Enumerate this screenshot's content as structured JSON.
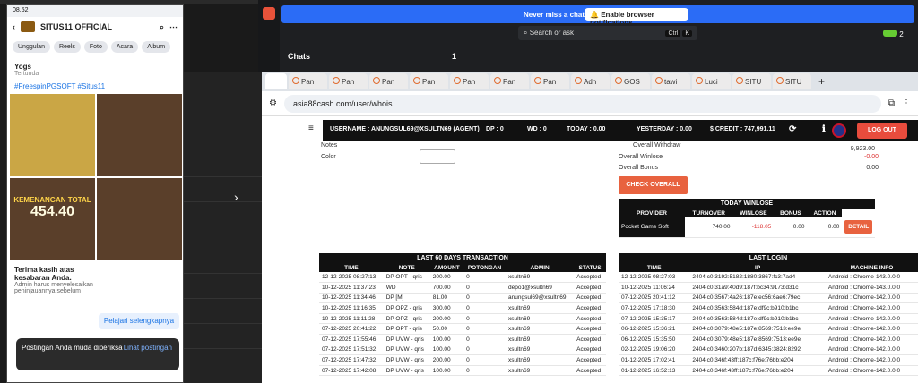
{
  "phone": {
    "status_time": "08.52",
    "page_title": "SITUS11 OFFICIAL",
    "chips": [
      "Unggulan",
      "Reels",
      "Foto",
      "Acara",
      "Album"
    ],
    "post_author": "Yogs",
    "post_sub": "Tertunda",
    "post_tags": "#FreespinPGSOFT #Situs11",
    "tile_caption": "KEMENANGAN TOTAL",
    "tile_value": "454.40",
    "ad_title": "Terima kasih atas kesabaran Anda.",
    "ad_body": "Admin harus menyelesaikan peninjauannya sebelum",
    "learn_more": "Pelajari selengkapnya",
    "toast_text": "Postingan Anda muda diperiksa",
    "toast_action": "Lihat postingan"
  },
  "chat": {
    "banner_msg": "Never miss a chat!",
    "banner_btn": "Enable browser notifications",
    "search": "Search or ask",
    "kbd1": "Ctrl",
    "kbd2": "K",
    "chats": "Chats",
    "count": "1",
    "badge": "2"
  },
  "browser": {
    "tabs": [
      "Pan",
      "Pan",
      "Pan",
      "Pan",
      "Pan",
      "Pan",
      "Pan",
      "Adn",
      "GOS",
      "tawi",
      "Luci",
      "SITU",
      "SITU"
    ],
    "url": "asia88cash.com/user/whois"
  },
  "site": {
    "username": "USERNAME : ANUNGSUL69@XSULTN69 (AGENT)",
    "dp": "DP : 0",
    "wd": "WD : 0",
    "today": "TODAY : 0.00",
    "yesterday": "YESTERDAY : 0.00",
    "credit": "$ CREDIT : 747,991.11",
    "logout": "LOG OUT",
    "notes_label": "Notes",
    "color_label": "Color",
    "overall_withdraw": "Overall Withdraw",
    "overall_withdraw_val": "9,923.00",
    "overall_winlose": "Overall Winlose",
    "overall_winlose_val": "-0.00",
    "overall_bonus": "Overall Bonus",
    "overall_bonus_val": "0.00",
    "check_overall": "CHECK OVERALL",
    "today_winlose_title": "TODAY WINLOSE",
    "winlose_headers": [
      "PROVIDER",
      "TURNOVER",
      "WINLOSE",
      "BONUS",
      "ACTION"
    ],
    "winlose_row": [
      "Pocket Game Soft",
      "740.00",
      "-118.05",
      "0.00",
      "0.00"
    ],
    "detail": "DETAIL",
    "tx_title": "LAST 60 DAYS TRANSACTION",
    "tx_headers": [
      "TIME",
      "NOTE",
      "AMOUNT",
      "POTONGAN",
      "ADMIN",
      "STATUS"
    ],
    "tx_rows": [
      [
        "12-12-2025 08:27:13",
        "DP OPT - qris",
        "200.00",
        "0",
        "xsultn69",
        "Accepted"
      ],
      [
        "10-12-2025 11:37:23",
        "WD",
        "700.00",
        "0",
        "depo1@xsultn69",
        "Accepted"
      ],
      [
        "10-12-2025 11:34:46",
        "DP [M]",
        "81.00",
        "0",
        "anungsul69@xsultn69",
        "Accepted"
      ],
      [
        "10-12-2025 11:16:35",
        "DP OPZ - qris",
        "300.00",
        "0",
        "xsultn69",
        "Accepted"
      ],
      [
        "10-12-2025 11:11:28",
        "DP OPZ - qris",
        "200.00",
        "0",
        "xsultn69",
        "Accepted"
      ],
      [
        "07-12-2025 20:41:22",
        "DP OPT - qris",
        "50.00",
        "0",
        "xsultn69",
        "Accepted"
      ],
      [
        "07-12-2025 17:55:46",
        "DP UVW - qris",
        "100.00",
        "0",
        "xsultn69",
        "Accepted"
      ],
      [
        "07-12-2025 17:51:32",
        "DP UVW - qris",
        "100.00",
        "0",
        "xsultn69",
        "Accepted"
      ],
      [
        "07-12-2025 17:47:32",
        "DP UVW - qris",
        "200.00",
        "0",
        "xsultn69",
        "Accepted"
      ],
      [
        "07-12-2025 17:42:08",
        "DP UVW - qris",
        "100.00",
        "0",
        "xsultn69",
        "Accepted"
      ]
    ],
    "login_title": "LAST LOGIN",
    "login_headers": [
      "TIME",
      "IP",
      "MACHINE INFO"
    ],
    "login_rows": [
      [
        "12-12-2025 08:27:03",
        "2404:c0:3192:5182:1880:3867:fc3:7ad4",
        "Android : Chrome-143.0.0.0"
      ],
      [
        "10-12-2025 11:06:24",
        "2404:c0:31a9:40d9:187f:bc34:9173:d31c",
        "Android : Chrome-143.0.0.0"
      ],
      [
        "07-12-2025 20:41:12",
        "2404:c0:3567:4a26:187e:ec56:6ae6:79ec",
        "Android : Chrome-142.0.0.0"
      ],
      [
        "07-12-2025 17:18:30",
        "2404:c0:3563:584d:187e:df9c:b910:b1bc",
        "Android : Chrome-142.0.0.0"
      ],
      [
        "07-12-2025 15:35:17",
        "2404:c0:3563:584d:187e:df9c:b910:b1bc",
        "Android : Chrome-142.0.0.0"
      ],
      [
        "06-12-2025 15:36:21",
        "2404:c0:3079:48e5:187e:8569:7513:ee9e",
        "Android : Chrome-142.0.0.0"
      ],
      [
        "06-12-2025 15:35:50",
        "2404:c0:3079:48e5:187e:8569:7513:ee9e",
        "Android : Chrome-142.0.0.0"
      ],
      [
        "02-12-2025 19:06:20",
        "2404:c0:3460:207b:187d:6345:3824:8292",
        "Android : Chrome-142.0.0.0"
      ],
      [
        "01-12-2025 17:02:41",
        "2404:c0:346f:43ff:187c:f76e:76bb:e204",
        "Android : Chrome-142.0.0.0"
      ],
      [
        "01-12-2025 16:52:13",
        "2404:c0:346f:43ff:187c:f76e:76bb:e204",
        "Android : Chrome-142.0.0.0"
      ]
    ]
  }
}
